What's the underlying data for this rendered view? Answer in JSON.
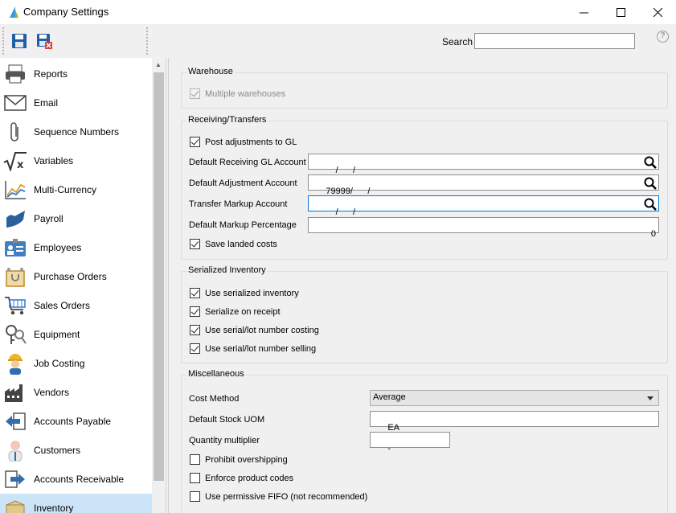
{
  "window": {
    "title": "Company Settings"
  },
  "toolbar": {
    "search_label": "Search",
    "search_value": ""
  },
  "sidebar": {
    "items": [
      {
        "label": "Reports",
        "icon": "printer-icon"
      },
      {
        "label": "Email",
        "icon": "envelope-icon"
      },
      {
        "label": "Sequence Numbers",
        "icon": "paperclip-icon"
      },
      {
        "label": "Variables",
        "icon": "square-root-icon"
      },
      {
        "label": "Multi-Currency",
        "icon": "chart-icon"
      },
      {
        "label": "Payroll",
        "icon": "payroll-icon"
      },
      {
        "label": "Employees",
        "icon": "employee-card-icon"
      },
      {
        "label": "Purchase Orders",
        "icon": "purchase-bag-icon"
      },
      {
        "label": "Sales Orders",
        "icon": "shopping-cart-icon"
      },
      {
        "label": "Equipment",
        "icon": "keys-icon"
      },
      {
        "label": "Job Costing",
        "icon": "worker-icon"
      },
      {
        "label": "Vendors",
        "icon": "factory-icon"
      },
      {
        "label": "Accounts Payable",
        "icon": "arrow-left-box-icon"
      },
      {
        "label": "Customers",
        "icon": "person-icon"
      },
      {
        "label": "Accounts Receivable",
        "icon": "arrow-right-box-icon"
      },
      {
        "label": "Inventory",
        "icon": "box-icon"
      }
    ],
    "selected": "Inventory"
  },
  "warehouse": {
    "title": "Warehouse",
    "multiple_warehouses": {
      "label": "Multiple warehouses",
      "checked": true,
      "disabled": true
    }
  },
  "receiving": {
    "title": "Receiving/Transfers",
    "post_adjustments": {
      "label": "Post adjustments to GL",
      "checked": true
    },
    "receiving_gl": {
      "label": "Default Receiving GL Account",
      "value": "    /      /"
    },
    "adjustment_account": {
      "label": "Default Adjustment Account",
      "value": "79999/      /"
    },
    "transfer_markup": {
      "label": "Transfer Markup Account",
      "value": "    /      /"
    },
    "markup_pct": {
      "label": "Default Markup Percentage",
      "value": "0"
    },
    "landed_costs": {
      "label": "Save landed costs",
      "checked": true
    }
  },
  "serialized": {
    "title": "Serialized Inventory",
    "use_serialized": {
      "label": "Use serialized inventory",
      "checked": true
    },
    "serialize_receipt": {
      "label": "Serialize on receipt",
      "checked": true
    },
    "lot_costing": {
      "label": "Use serial/lot number costing",
      "checked": true
    },
    "lot_selling": {
      "label": "Use serial/lot number selling",
      "checked": true
    }
  },
  "misc": {
    "title": "Miscellaneous",
    "cost_method": {
      "label": "Cost Method",
      "value": "Average"
    },
    "stock_uom": {
      "label": "Default Stock UOM",
      "value": "EA"
    },
    "qty_multiplier": {
      "label": "Quantity multiplier",
      "value": "-"
    },
    "prohibit_overshipping": {
      "label": "Prohibit overshipping",
      "checked": false
    },
    "enforce_codes": {
      "label": "Enforce product codes",
      "checked": false
    },
    "permissive_fifo": {
      "label": "Use permissive FIFO (not recommended)",
      "checked": false
    }
  },
  "colors": {
    "selection": "#cce4f7",
    "accent": "#0078d7",
    "save_blue": "#1f5fa8",
    "delete_red": "#d9433b"
  }
}
